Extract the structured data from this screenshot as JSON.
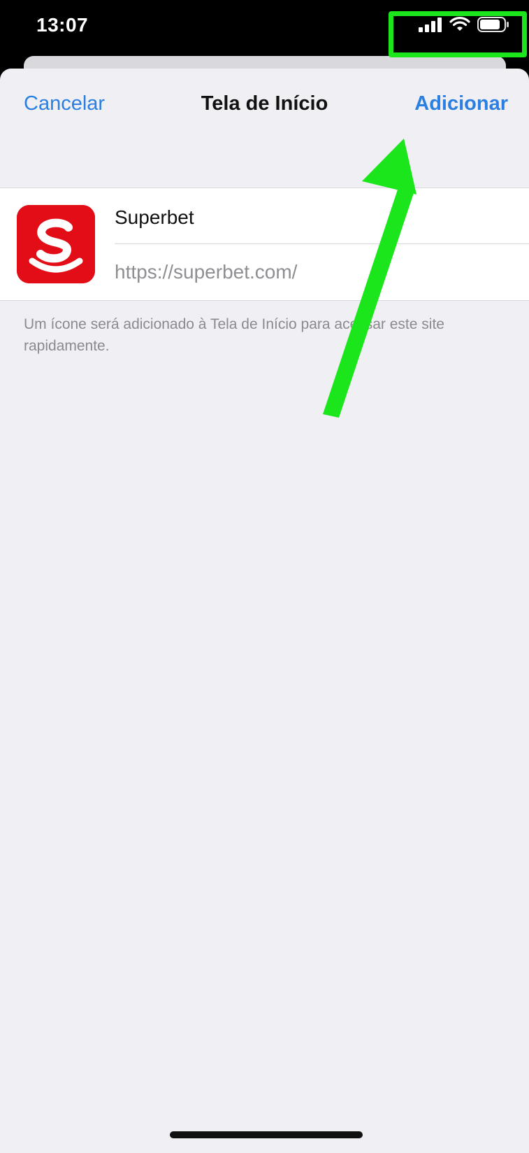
{
  "status_bar": {
    "time": "13:07",
    "icons": [
      "cellular-signal-icon",
      "wifi-icon",
      "battery-icon"
    ]
  },
  "sheet": {
    "nav": {
      "cancel_label": "Cancelar",
      "title": "Tela de Início",
      "add_label": "Adicionar"
    },
    "form": {
      "name_value": "Superbet",
      "url_value": "https://superbet.com/",
      "icon": "superbet-app-icon"
    },
    "footnote": "Um ícone será adicionado à Tela de Início para acessar este site rapidamente."
  },
  "annotation": {
    "highlight_color": "#1be51b",
    "target": "add-button"
  },
  "colors": {
    "accent": "#2b7fe0",
    "brand": "#e30d17",
    "sheet_background": "#f0eff4"
  }
}
